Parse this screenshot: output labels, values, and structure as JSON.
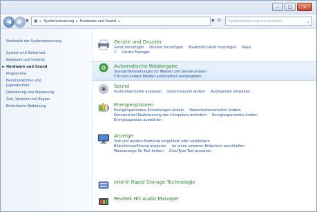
{
  "address": {
    "crumbs": [
      "Systemsteuerung",
      "Hardware und Sound"
    ],
    "search_placeholder": "Systemsteuerung durchsuchen"
  },
  "sidebar": {
    "items": [
      {
        "label": "Startseite der Systemsteuerung",
        "active": false
      },
      {
        "label": "System und Sicherheit",
        "active": false
      },
      {
        "label": "Netzwerk und Internet",
        "active": false
      },
      {
        "label": "Hardware und Sound",
        "active": true
      },
      {
        "label": "Programme",
        "active": false
      },
      {
        "label": "Benutzerkonten und",
        "active": false
      },
      {
        "label": "Jugendschutz",
        "active": false
      },
      {
        "label": "Darstellung und Anpassung",
        "active": false
      },
      {
        "label": "Zeit, Sprache und Region",
        "active": false
      },
      {
        "label": "Erleichterte Bedienung",
        "active": false
      }
    ]
  },
  "sections": [
    {
      "title": "Geräte und Drucker",
      "icon": "printer-icon",
      "links": [
        "Gerät hinzufügen",
        "Drucker hinzufügen",
        "Bluetooth-Gerät hinzufügen",
        "Maus",
        "Geräte-Manager"
      ]
    },
    {
      "title": "Automatische Wiedergabe",
      "icon": "autoplay-icon",
      "links": [
        "Standardeinstellungen für Medien und Geräte ändern",
        "CDs und andere Medien automatisch wiedergeben"
      ]
    },
    {
      "title": "Sound",
      "icon": "speaker-icon",
      "links": [
        "Systemlautstärke anpassen",
        "Systemsounds ändern",
        "Audiogeräte verwalten"
      ]
    },
    {
      "title": "Energieoptionen",
      "icon": "battery-icon",
      "links": [
        "Energiesparmodus-Einstellungen ändern",
        "Netzschalterverhalten ändern",
        "Kennwort bei Reaktivierung des Computers anfordern",
        "Energiesparmodus ändern",
        "Energiesparplan auswählen"
      ]
    },
    {
      "title": "Anzeige",
      "icon": "monitor-icon",
      "links": [
        "Text und weitere Elemente vergrößern oder verkleinern",
        "Bildschirmauflösung anpassen",
        "An einen externen Bildschirm anschließen",
        "Mausanzeige für Text ändern",
        "ClearType-Text anpassen"
      ]
    },
    {
      "title": "Intel® Rapid Storage Technologie",
      "icon": "storage-icon",
      "links": []
    },
    {
      "title": "Realtek HD Audio Manager",
      "icon": "audio-manager-icon",
      "links": []
    }
  ]
}
